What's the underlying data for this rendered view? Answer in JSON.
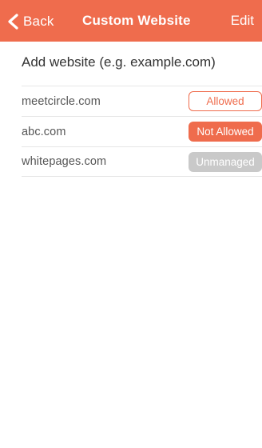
{
  "nav": {
    "back_label": "Back",
    "title": "Custom Website",
    "edit_label": "Edit",
    "back_icon": "chevron-left-icon"
  },
  "add_website": {
    "placeholder": "Add website (e.g. example.com)"
  },
  "websites": [
    {
      "domain": "meetcircle.com",
      "status": "Allowed"
    },
    {
      "domain": "abc.com",
      "status": "Not Allowed"
    },
    {
      "domain": "whitepages.com",
      "status": "Unmanaged"
    }
  ],
  "colors": {
    "accent": "#ef6c4d",
    "unmanaged": "#c9c9c9"
  }
}
